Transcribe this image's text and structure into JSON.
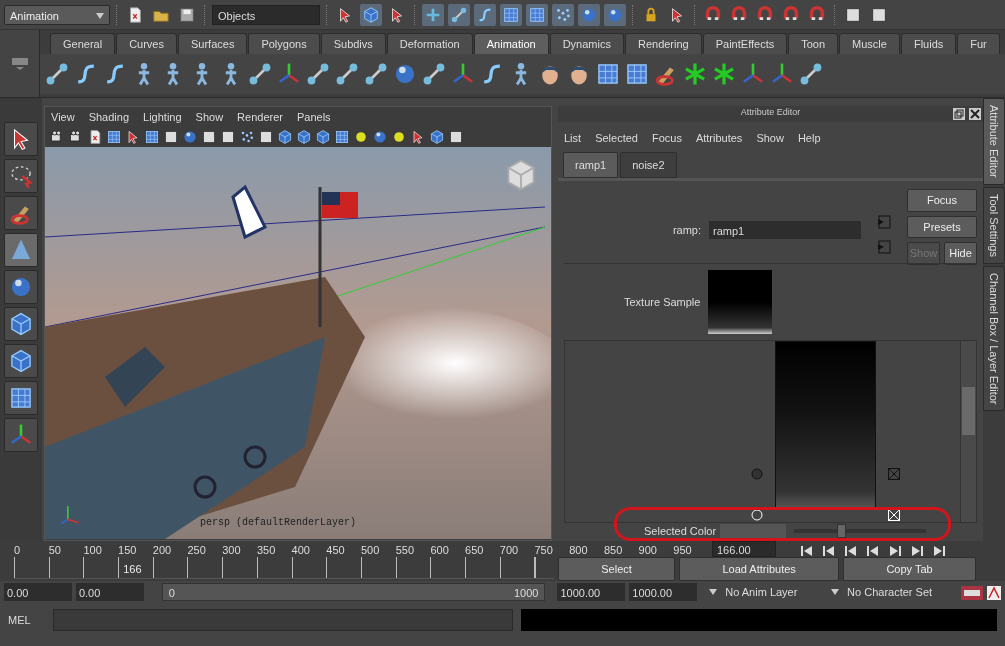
{
  "menu_set": "Animation",
  "object_field": "Objects",
  "shelf_tabs": [
    {
      "label": "General",
      "selected": false
    },
    {
      "label": "Curves",
      "selected": false
    },
    {
      "label": "Surfaces",
      "selected": false
    },
    {
      "label": "Polygons",
      "selected": false
    },
    {
      "label": "Subdivs",
      "selected": false
    },
    {
      "label": "Deformation",
      "selected": false
    },
    {
      "label": "Animation",
      "selected": true
    },
    {
      "label": "Dynamics",
      "selected": false
    },
    {
      "label": "Rendering",
      "selected": false
    },
    {
      "label": "PaintEffects",
      "selected": false
    },
    {
      "label": "Toon",
      "selected": false
    },
    {
      "label": "Muscle",
      "selected": false
    },
    {
      "label": "Fluids",
      "selected": false
    },
    {
      "label": "Fur",
      "selected": false
    }
  ],
  "viewport": {
    "menu": [
      "View",
      "Shading",
      "Lighting",
      "Show",
      "Renderer",
      "Panels"
    ],
    "camera_label": "persp (defaultRenderLayer)"
  },
  "attribute_editor": {
    "title": "Attribute Editor",
    "menu": [
      "List",
      "Selected",
      "Focus",
      "Attributes",
      "Show",
      "Help"
    ],
    "tabs": [
      {
        "label": "ramp1",
        "selected": true
      },
      {
        "label": "noise2",
        "selected": false
      }
    ],
    "node_label": "ramp:",
    "node_value": "ramp1",
    "buttons": [
      {
        "label": "Focus",
        "disabled": false
      },
      {
        "label": "Presets",
        "disabled": false
      },
      {
        "label": "Show",
        "disabled": true
      },
      {
        "label": "Hide",
        "disabled": false
      }
    ],
    "texture_sample_label": "Texture Sample",
    "ramp_handles": [
      {
        "selected": false
      },
      {
        "selected": true
      }
    ],
    "selected_color": {
      "label": "Selected Color",
      "level": 0.35
    },
    "bottom_buttons": [
      "Select",
      "Load Attributes",
      "Copy Tab"
    ]
  },
  "side_tabs": [
    {
      "label": "Attribute Editor",
      "selected": true
    },
    {
      "label": "Tool Settings",
      "selected": false
    },
    {
      "label": "Channel Box / Layer Editor",
      "selected": false
    }
  ],
  "timeline": {
    "ticks": [
      "0",
      "50",
      "100",
      "150",
      "200",
      "250",
      "300",
      "350",
      "400",
      "450",
      "500",
      "550",
      "600",
      "650",
      "700",
      "750",
      "800",
      "850",
      "900",
      "950"
    ],
    "current_frame": "166",
    "current_time": "166.00",
    "level": 0.166
  },
  "range": {
    "level": 1,
    "start": "0.00",
    "playback_start": "0.00",
    "slider_start": "0",
    "slider_end": "1000",
    "playback_end": "1000.00",
    "end": "1000.00",
    "anim_layer": "No Anim Layer",
    "character_set": "No Character Set"
  },
  "command_line": {
    "label": "MEL"
  }
}
